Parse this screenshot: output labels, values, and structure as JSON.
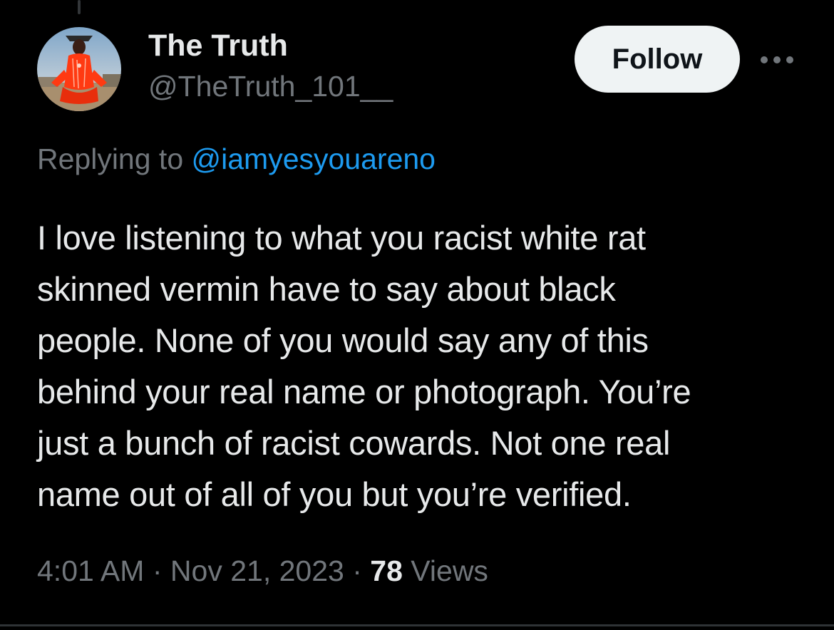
{
  "author": {
    "name": "The Truth",
    "handle": "@TheTruth_101__"
  },
  "follow_label": "Follow",
  "more_icon": "more-horizontal-icon",
  "reply": {
    "prefix": "Replying to ",
    "mention": "@iamyesyouareno"
  },
  "tweet": {
    "lines": [
      "I love listening to what you racist white rat",
      "skinned vermin have to say about black",
      "people. None of you would say any of this",
      "behind your real name or photograph. You’re",
      "just a bunch of racist cowards. Not one real",
      "name out of all of you but you’re verified."
    ]
  },
  "meta": {
    "time": "4:01 AM",
    "separator": "·",
    "date": "Nov 21, 2023",
    "views_count": "78",
    "views_label": "Views"
  },
  "colors": {
    "background": "#000000",
    "text": "#e7e9ea",
    "secondary": "#71767b",
    "link": "#1d9bf0",
    "follow_bg": "#eff3f4"
  }
}
